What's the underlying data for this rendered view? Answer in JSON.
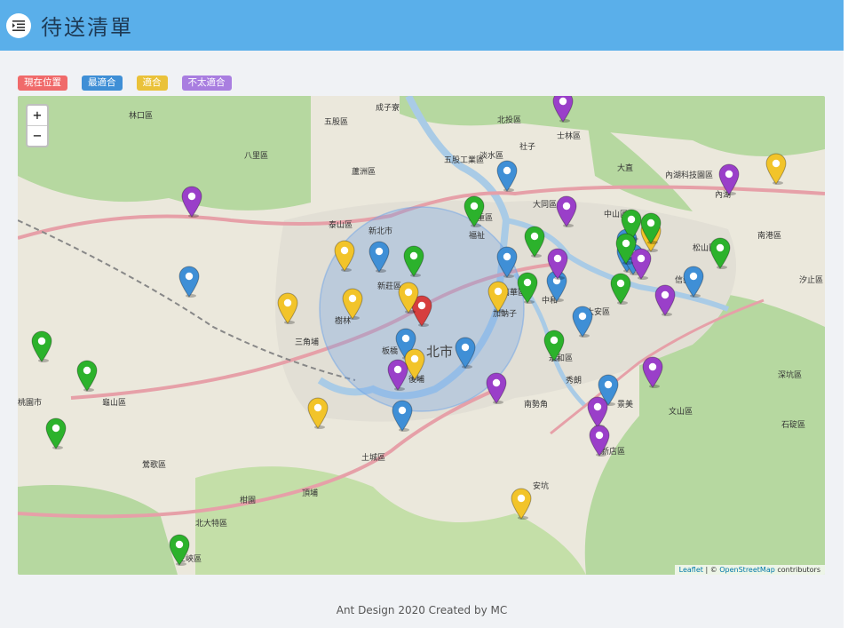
{
  "header": {
    "title": "待送清單",
    "menu_icon": "menu-fold-icon"
  },
  "legend": [
    {
      "label": "現在位置",
      "color": "#f06a6a"
    },
    {
      "label": "最適合",
      "color": "#3f8fd6"
    },
    {
      "label": "適合",
      "color": "#eac23a"
    },
    {
      "label": "不太適合",
      "color": "#a97ee0"
    }
  ],
  "map": {
    "zoom_in": "+",
    "zoom_out": "−",
    "attribution": {
      "leaflet": "Leaflet",
      "sep": " | © ",
      "osm": "OpenStreetMap",
      "suffix": " contributors"
    },
    "labels": [
      "成子寮",
      "五股區",
      "林口區",
      "士林區",
      "大直",
      "內湖科技園區",
      "內湖",
      "新莊區",
      "三重區",
      "福祉",
      "大同區",
      "中山區",
      "南港區",
      "加蚋子",
      "三角埔",
      "北市",
      "中和",
      "永和區",
      "後埔",
      "秀朗",
      "南勢角",
      "新店區",
      "文山區",
      "土城區",
      "鶯歌區",
      "三峽區",
      "安坑",
      "龜山區",
      "桃園市",
      "頂埔",
      "蘆洲區",
      "北投區",
      "泰山區",
      "樹林",
      "板橋",
      "松山區",
      "信義區",
      "大安區",
      "萬華區",
      "景美",
      "深坑區",
      "石碇區",
      "汐止區",
      "北大特區",
      "柑園",
      "八里區",
      "淡水區",
      "新北市",
      "五股工業區",
      "社子"
    ],
    "markers": [
      {
        "type": "current",
        "color": "#d63e3e"
      },
      {
        "type": "best",
        "color": "#3f8fd6"
      },
      {
        "type": "suitable",
        "color": "#f2c42a"
      },
      {
        "type": "not-suitable",
        "color": "#9a3fc9"
      },
      {
        "type": "other",
        "color": "#2cb22c"
      }
    ]
  },
  "footer": "Ant Design 2020 Created by MC"
}
